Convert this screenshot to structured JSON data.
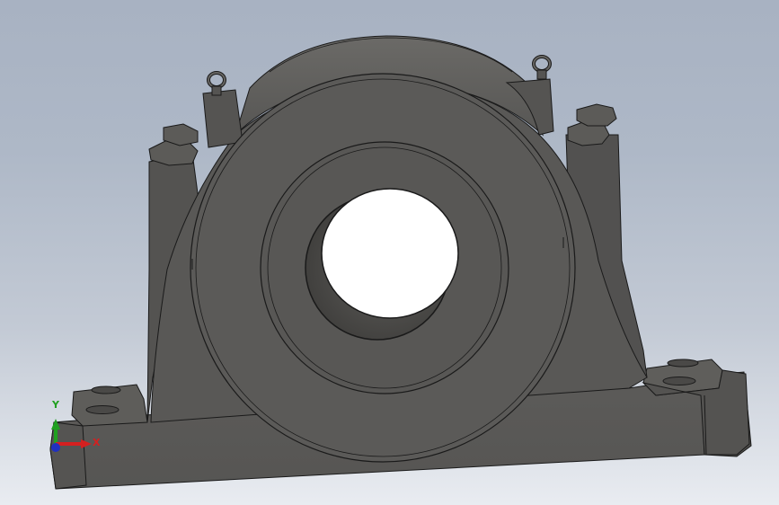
{
  "viewport": {
    "background_top": "#a8b2c2",
    "background_bottom": "#e9ecf1"
  },
  "model": {
    "body_color": "#5a5957",
    "edge_color": "#1a1a1a",
    "highlight_color": "#6a6966",
    "shadow_color": "#474643"
  },
  "triad": {
    "x_label": "X",
    "y_label": "Y",
    "x_color": "#d42020",
    "y_color": "#20a020",
    "z_color": "#2030c0"
  }
}
